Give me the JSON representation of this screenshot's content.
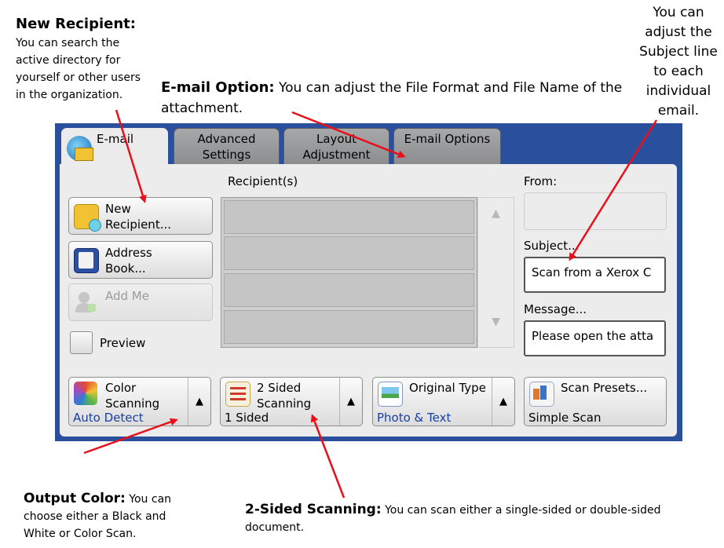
{
  "annotations": {
    "new_recipient_title": "New Recipient:",
    "new_recipient_lines": [
      "You can search the",
      "active directory for",
      "yourself or other users",
      "in the organization."
    ],
    "email_option_title": "E-mail Option:",
    "email_option_line1": " You can adjust the File Format and File Name of the",
    "email_option_line2": "attachment.",
    "subject_lines": [
      "You can",
      "adjust the",
      "Subject line",
      "to each",
      "individual",
      "email."
    ],
    "output_color_title": "Output Color:",
    "output_color_line1": " You can",
    "output_color_lines": [
      "choose either a Black and",
      "White or Color Scan."
    ],
    "two_sided_title": "2-Sided Scanning:",
    "two_sided_line1": " You can scan either a single-sided or double-sided",
    "two_sided_line2": "document."
  },
  "tabs": [
    {
      "label": "E-mail"
    },
    {
      "label": "Advanced Settings",
      "line1": "Advanced",
      "line2": "Settings"
    },
    {
      "label": "Layout Adjustment",
      "line1": "Layout",
      "line2": "Adjustment"
    },
    {
      "label": "E-mail Options"
    }
  ],
  "left_buttons": {
    "new_recipient": {
      "line1": "New",
      "line2": "Recipient..."
    },
    "address_book": {
      "line1": "Address",
      "line2": "Book..."
    },
    "add_me": "Add Me",
    "preview": "Preview"
  },
  "recipients_header": "Recipient(s)",
  "scroll": {
    "up": "▲",
    "down": "▼"
  },
  "right_fields": {
    "from_label": "From:",
    "from_value": "",
    "subject_label": "Subject...",
    "subject_value": "Scan from a Xerox C",
    "message_label": "Message...",
    "message_value": "Please open the atta"
  },
  "functions": [
    {
      "line1": "Color",
      "line2": "Scanning",
      "value": "Auto Detect",
      "arrow": "▲"
    },
    {
      "line1": "2 Sided",
      "line2": "Scanning",
      "value": "1 Sided",
      "arrow": "▲"
    },
    {
      "line1": "Original Type",
      "value": "Photo & Text",
      "arrow": "▲"
    },
    {
      "line1": "Scan Presets...",
      "value": "Simple Scan"
    }
  ],
  "colors": {
    "panel_frame": "#2a4f9c",
    "annotation_arrow": "#e8101a",
    "value_text": "#1a3e9f"
  }
}
